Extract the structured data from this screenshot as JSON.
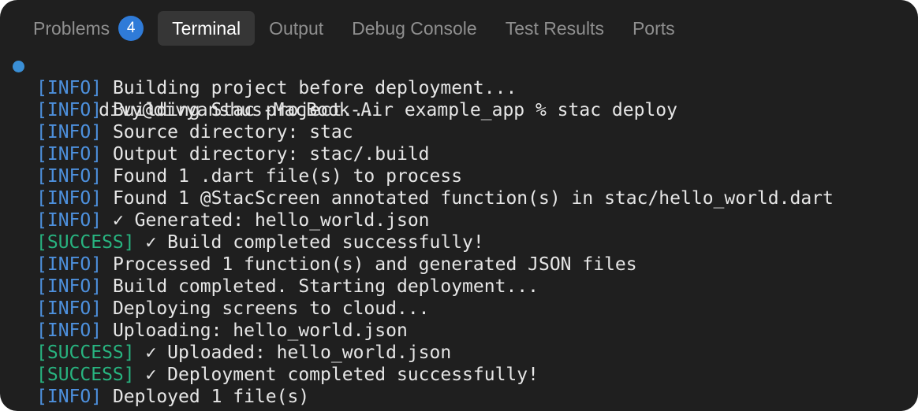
{
  "tabs": [
    {
      "label": "Problems",
      "badge": "4",
      "active": false
    },
    {
      "label": "Terminal",
      "active": true
    },
    {
      "label": "Output",
      "active": false
    },
    {
      "label": "Debug Console",
      "active": false
    },
    {
      "label": "Test Results",
      "active": false
    },
    {
      "label": "Ports",
      "active": false
    }
  ],
  "terminal": {
    "prompt": "divy@divyanshus-MacBook-Air example_app % stac deploy",
    "lines": [
      {
        "tag": "[INFO]",
        "text": " Building project before deployment..."
      },
      {
        "tag": "[INFO]",
        "text": " Building Stac project..."
      },
      {
        "tag": "[INFO]",
        "text": " Source directory: stac"
      },
      {
        "tag": "[INFO]",
        "text": " Output directory: stac/.build"
      },
      {
        "tag": "[INFO]",
        "text": " Found 1 .dart file(s) to process"
      },
      {
        "tag": "[INFO]",
        "text": " Found 1 @StacScreen annotated function(s) in stac/hello_world.dart"
      },
      {
        "tag": "[INFO]",
        "text": " ✓ Generated: hello_world.json"
      },
      {
        "tag": "[SUCCESS]",
        "text": " ✓ Build completed successfully!"
      },
      {
        "tag": "[INFO]",
        "text": " Processed 1 function(s) and generated JSON files"
      },
      {
        "tag": "[INFO]",
        "text": " Build completed. Starting deployment..."
      },
      {
        "tag": "[INFO]",
        "text": " Deploying screens to cloud..."
      },
      {
        "tag": "[INFO]",
        "text": " Uploading: hello_world.json"
      },
      {
        "tag": "[SUCCESS]",
        "text": " ✓ Uploaded: hello_world.json"
      },
      {
        "tag": "[SUCCESS]",
        "text": " ✓ Deployment completed successfully!"
      },
      {
        "tag": "[INFO]",
        "text": " Deployed 1 file(s)"
      }
    ]
  },
  "colors": {
    "background": "#1f1f1f",
    "active_tab_bg": "#363636",
    "info": "#4d90dd",
    "success": "#28b480",
    "badge": "#2f7bd8",
    "prompt_dot": "#3a8fd6"
  }
}
